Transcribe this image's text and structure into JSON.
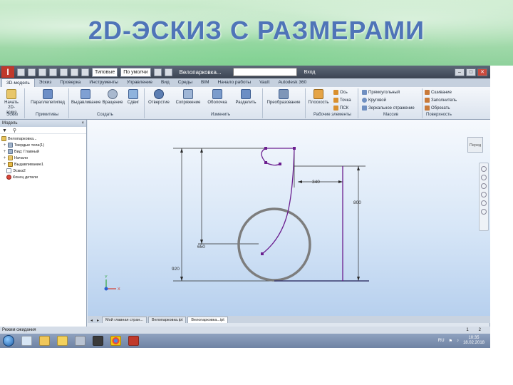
{
  "slide": {
    "title": "2D-ЭСКИЗ С РАЗМЕРАМИ"
  },
  "quickbar": {
    "material": "Типовые",
    "appearance": "По умолчи",
    "doc_title": "Велопарковка...",
    "login": "Вход"
  },
  "tabs": [
    "3D-модель",
    "Эскиз",
    "Проверка",
    "Инструменты",
    "Управление",
    "Вид",
    "Среды",
    "BIM",
    "Начало работы",
    "Vault",
    "Autodesk 360"
  ],
  "ribbon": {
    "start_sketch": "Начать\n2D-эскиз",
    "parallelepiped": "Параллелепипед",
    "extrude": "Выдавливание",
    "revolve": "Вращение",
    "sweep": "Сдвиг",
    "hole": "Отверстие",
    "fillet": "Сопряжение",
    "shell": "Оболочка",
    "split": "Разделить",
    "convert": "Преобразование",
    "plane": "Плоскость",
    "axis": "Ось",
    "point": "Точка",
    "ucs": "ПСК",
    "rect": "Прямоугольный",
    "circular": "Круговой",
    "mirror": "Зеркальное отражение",
    "stitch": "Сшивание",
    "patch": "Заполнитель",
    "trim": "Обрезать",
    "groups": {
      "sketch": "Эскиз",
      "primitives": "Примитивы",
      "create": "Создать",
      "modify": "Изменить",
      "work": "Рабочие элементы",
      "array": "Массив",
      "surface": "Поверхность"
    }
  },
  "browser": {
    "header": "Модель",
    "items": [
      "Велопарковка...",
      "Твердые тела(1)",
      "Вид: Главный",
      "Начало",
      "Выдавливание1",
      "Эскиз2",
      "Конец детали"
    ]
  },
  "viewcube": "Перед",
  "sketch": {
    "dim_340": "340",
    "dim_800": "800",
    "dim_650": "650",
    "dim_920": "920"
  },
  "doc_tabs": [
    "Мой главная стран...",
    "Велопарковка.ipt",
    "Велопарковка...ipt"
  ],
  "status": {
    "text": "Режим ожидания",
    "n1": "1",
    "n2": "2"
  },
  "taskbar": {
    "lang": "RU",
    "time": "10:35",
    "date": "18.02.2018"
  },
  "colors": {
    "title": "#4f74b8",
    "sketch_line": "#6b1e8f",
    "circle": "#7d7d7d"
  }
}
